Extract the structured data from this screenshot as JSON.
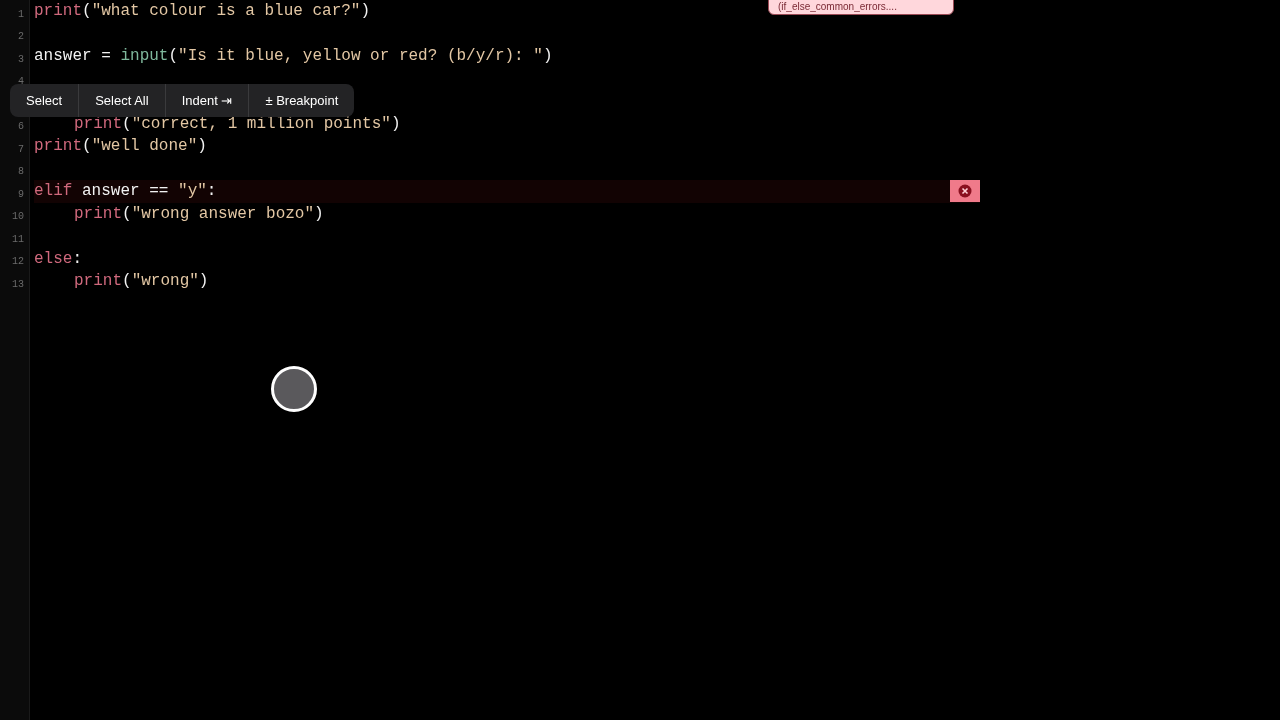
{
  "editor": {
    "lines": [
      {
        "number": "1",
        "kind": "top",
        "error": false,
        "tokens": [
          {
            "kind": "builtin",
            "text": "print"
          },
          {
            "kind": "plain",
            "text": "("
          },
          {
            "kind": "string",
            "text": "\"what colour is a blue car?\""
          },
          {
            "kind": "plain",
            "text": ")"
          }
        ]
      },
      {
        "number": "2",
        "error": false
      },
      {
        "number": "3",
        "kind": "top",
        "error": false,
        "tokens": [
          {
            "kind": "plain",
            "text": "answer = "
          },
          {
            "kind": "function",
            "text": "input"
          },
          {
            "kind": "plain",
            "text": "("
          },
          {
            "kind": "string",
            "text": "\"Is it blue, yellow or red? (b/y/r): \""
          },
          {
            "kind": "plain",
            "text": ")"
          }
        ]
      },
      {
        "number": "4",
        "error": false
      },
      {
        "error": false
      },
      {
        "number": "6",
        "kind": "nested",
        "error": false,
        "tokens": [
          {
            "kind": "builtin",
            "text": "print"
          },
          {
            "kind": "plain",
            "text": "("
          },
          {
            "kind": "string",
            "text": "\"correct, 1 million points\""
          },
          {
            "kind": "plain",
            "text": ")"
          }
        ]
      },
      {
        "number": "7",
        "kind": "top",
        "error": false,
        "tokens": [
          {
            "kind": "builtin",
            "text": "print"
          },
          {
            "kind": "plain",
            "text": "("
          },
          {
            "kind": "string",
            "text": "\"well done\""
          },
          {
            "kind": "plain",
            "text": ")"
          }
        ]
      },
      {
        "number": "8",
        "error": false
      },
      {
        "number": "9",
        "kind": "top",
        "error": true,
        "tokens": [
          {
            "kind": "keyword",
            "text": "elif"
          },
          {
            "kind": "plain",
            "text": " answer == "
          },
          {
            "kind": "string",
            "text": "\"y\""
          },
          {
            "kind": "plain",
            "text": ":"
          }
        ]
      },
      {
        "number": "10",
        "kind": "nested",
        "error": false,
        "tokens": [
          {
            "kind": "builtin",
            "text": "print"
          },
          {
            "kind": "plain",
            "text": "("
          },
          {
            "kind": "string",
            "text": "\"wrong answer bozo\""
          },
          {
            "kind": "plain",
            "text": ")"
          }
        ]
      },
      {
        "number": "11",
        "error": false
      },
      {
        "number": "12",
        "kind": "top",
        "error": false,
        "tokens": [
          {
            "kind": "keyword",
            "text": "else"
          },
          {
            "kind": "plain",
            "text": ":"
          }
        ]
      },
      {
        "number": "13",
        "kind": "nested",
        "error": false,
        "tokens": [
          {
            "kind": "builtin",
            "text": "print"
          },
          {
            "kind": "plain",
            "text": "("
          },
          {
            "kind": "string",
            "text": "\"wrong\""
          },
          {
            "kind": "plain",
            "text": ")"
          }
        ]
      }
    ]
  },
  "context_menu": {
    "items": [
      "Select",
      "Select All",
      "Indent ⇥",
      "± Breakpoint"
    ]
  },
  "notification": {
    "text": "(if_else_common_errors...."
  }
}
